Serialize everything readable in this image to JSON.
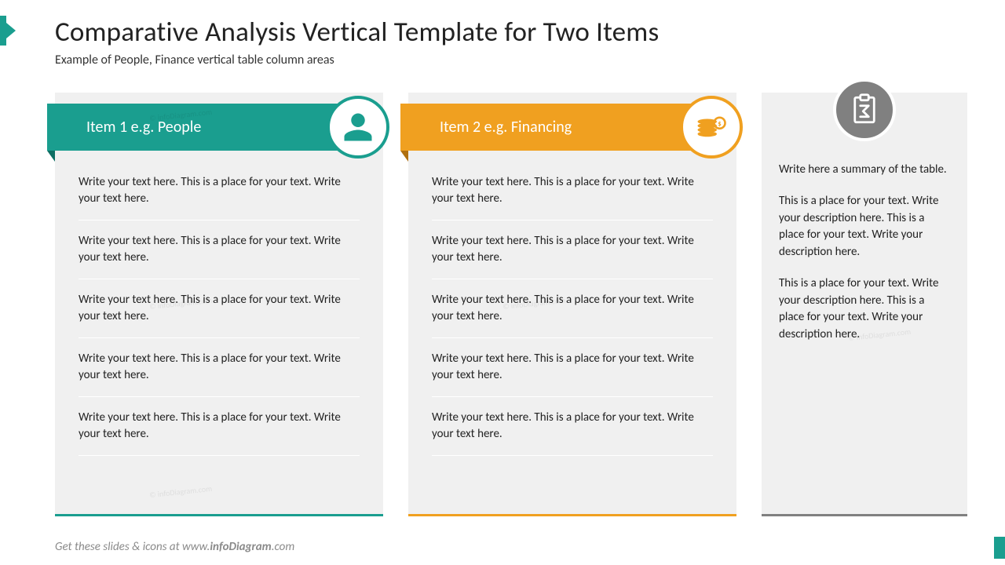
{
  "title": "Comparative Analysis Vertical Template for Two Items",
  "subtitle": "Example of People, Finance vertical table column areas",
  "columns": {
    "col1": {
      "header": "Item 1 e.g. People",
      "rows": [
        "Write your text here. This is a place for your text. Write your text here.",
        "Write your text here. This is a place for your text. Write your text here.",
        "Write your text here. This is a place for your text. Write your text here.",
        "Write your text here. This is a place for your text. Write your text here.",
        "Write your text here. This is a place for your text. Write your text here."
      ]
    },
    "col2": {
      "header": "Item 2 e.g. Financing",
      "rows": [
        "Write your text here. This is a place for your text. Write your text here.",
        "Write your text here. This is a place for your text. Write your text here.",
        "Write your text here. This is a place for your text. Write your text here.",
        "Write your text here. This is a place for your text. Write your text here.",
        "Write your text here. This is a place for your text. Write your text here."
      ]
    },
    "col3": {
      "summary": [
        "Write here a summary of the table.",
        "This is a place for your text. Write your description here. This is a place for your text. Write your description here.",
        "This is a place for your text. Write your description here. This is a place for your text. Write your description here."
      ]
    }
  },
  "footer_prefix": "Get these slides & icons at www.",
  "footer_brand": "infoDiagram",
  "footer_suffix": ".com",
  "watermark": "© infoDiagram.com",
  "colors": {
    "teal": "#1a9e8f",
    "orange": "#f0a020",
    "grey": "#808080"
  }
}
